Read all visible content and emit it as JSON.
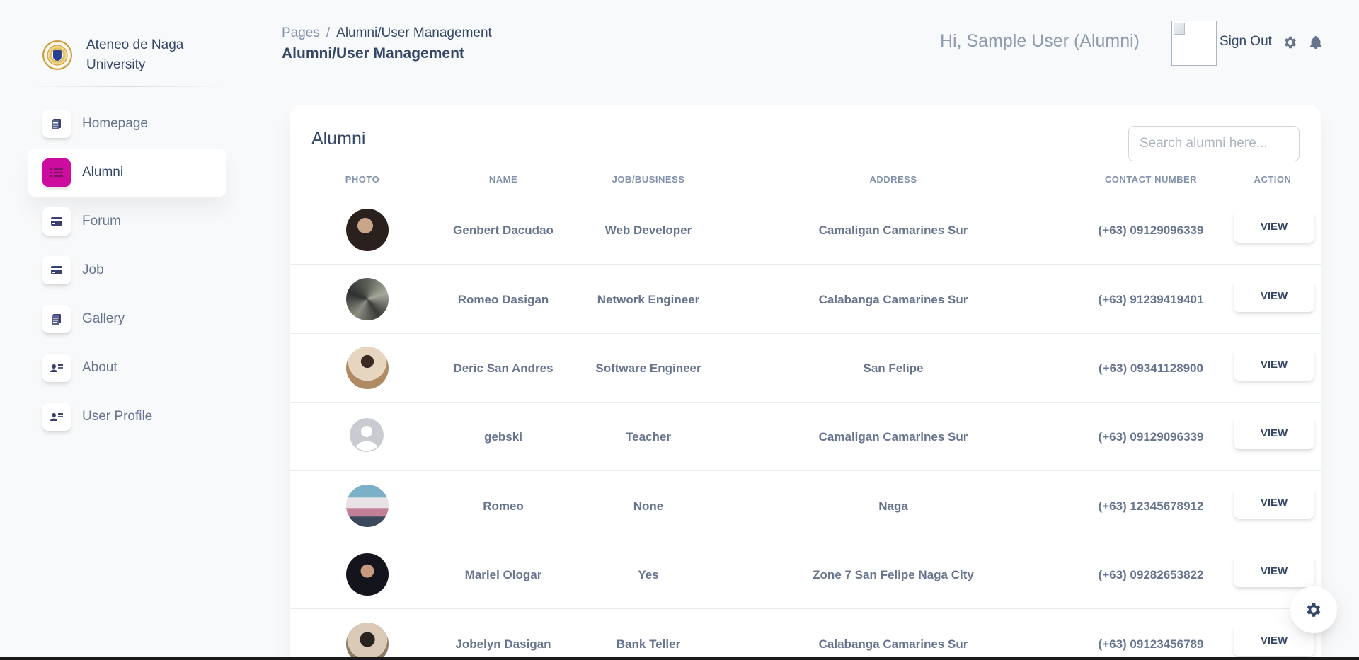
{
  "brand": {
    "name": "Ateneo de Naga University"
  },
  "sidebar": {
    "items": [
      {
        "label": "Homepage",
        "icon": "document-icon",
        "active": false
      },
      {
        "label": "Alumni",
        "icon": "list-icon",
        "active": true
      },
      {
        "label": "Forum",
        "icon": "credit-card-icon",
        "active": false
      },
      {
        "label": "Job",
        "icon": "credit-card-icon",
        "active": false
      },
      {
        "label": "Gallery",
        "icon": "document-icon",
        "active": false
      },
      {
        "label": "About",
        "icon": "user-card-icon",
        "active": false
      },
      {
        "label": "User Profile",
        "icon": "user-card-icon",
        "active": false
      }
    ]
  },
  "header": {
    "breadcrumb_root": "Pages",
    "breadcrumb_sep": "/",
    "breadcrumb_current": "Alumni/User Management",
    "title": "Alumni/User Management",
    "greeting": "Hi, Sample User (Alumni)",
    "signout": "Sign Out"
  },
  "card": {
    "title": "Alumni",
    "search_placeholder": "Search alumni here...",
    "columns": [
      "PHOTO",
      "NAME",
      "JOB/BUSINESS",
      "ADDRESS",
      "CONTACT NUMBER",
      "ACTION"
    ],
    "view_label": "VIEW",
    "rows": [
      {
        "name": "Genbert Dacudao",
        "job": "Web Developer",
        "address": "Camaligan Camarines Sur",
        "contact": "(+63) 09129096339"
      },
      {
        "name": "Romeo Dasigan",
        "job": "Network Engineer",
        "address": "Calabanga Camarines Sur",
        "contact": "(+63) 91239419401"
      },
      {
        "name": "Deric San Andres",
        "job": "Software Engineer",
        "address": "San Felipe",
        "contact": "(+63) 09341128900"
      },
      {
        "name": "gebski",
        "job": "Teacher",
        "address": "Camaligan Camarines Sur",
        "contact": "(+63) 09129096339"
      },
      {
        "name": "Romeo",
        "job": "None",
        "address": "Naga",
        "contact": "(+63) 12345678912"
      },
      {
        "name": "Mariel Ologar",
        "job": "Yes",
        "address": "Zone 7 San Felipe Naga City",
        "contact": "(+63) 09282653822"
      },
      {
        "name": "Jobelyn Dasigan",
        "job": "Bank Teller",
        "address": "Calabanga Camarines Sur",
        "contact": "(+63) 09123456789"
      }
    ]
  },
  "colors": {
    "accent": "#cb0c9f",
    "text": "#344767",
    "muted": "#67748e"
  }
}
